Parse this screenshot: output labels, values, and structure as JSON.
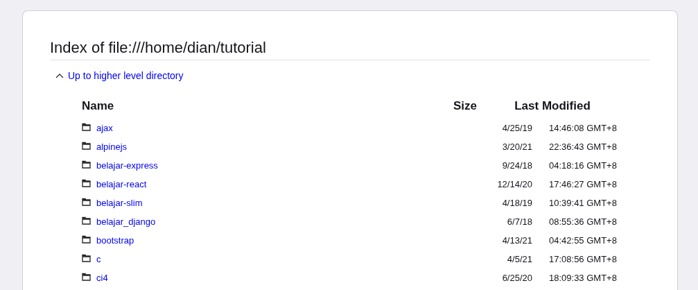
{
  "title": "Index of file:///home/dian/tutorial",
  "up_link": "Up to higher level directory",
  "columns": [
    "Name",
    "Size",
    "Last Modified"
  ],
  "rows": [
    {
      "kind": "folder",
      "name": "ajax",
      "size": "",
      "date": "4/25/19",
      "time": "14:46:08 GMT+8"
    },
    {
      "kind": "folder",
      "name": "alpinejs",
      "size": "",
      "date": "3/20/21",
      "time": "22:36:43 GMT+8"
    },
    {
      "kind": "folder",
      "name": "belajar-express",
      "size": "",
      "date": "9/24/18",
      "time": "04:18:16 GMT+8"
    },
    {
      "kind": "folder",
      "name": "belajar-react",
      "size": "",
      "date": "12/14/20",
      "time": "17:46:27 GMT+8"
    },
    {
      "kind": "folder",
      "name": "belajar-slim",
      "size": "",
      "date": "4/18/19",
      "time": "10:39:41 GMT+8"
    },
    {
      "kind": "folder",
      "name": "belajar_django",
      "size": "",
      "date": "6/7/18",
      "time": "08:55:36 GMT+8"
    },
    {
      "kind": "folder",
      "name": "bootstrap",
      "size": "",
      "date": "4/13/21",
      "time": "04:42:55 GMT+8"
    },
    {
      "kind": "folder",
      "name": "c",
      "size": "",
      "date": "4/5/21",
      "time": "17:08:56 GMT+8"
    },
    {
      "kind": "folder",
      "name": "ci4",
      "size": "",
      "date": "6/25/20",
      "time": "18:09:33 GMT+8"
    }
  ]
}
